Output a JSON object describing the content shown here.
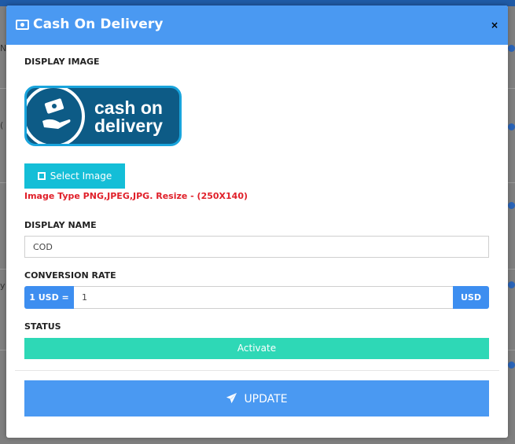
{
  "background": {
    "fragments": [
      "N",
      "(",
      "y"
    ]
  },
  "modal": {
    "title": "Cash On Delivery",
    "close_label": "×",
    "display_image_label": "DISPLAY IMAGE",
    "logo": {
      "line1": "cash on",
      "line2": "delivery"
    },
    "select_image_button": "Select Image",
    "image_hint": "Image Type PNG,JPEG,JPG. Resize - (250X140)",
    "display_name_label": "DISPLAY NAME",
    "display_name_value": "COD",
    "conversion_rate_label": "CONVERSION RATE",
    "rate_prefix": "1 USD =",
    "rate_value": "1",
    "rate_suffix": "USD",
    "status_label": "STATUS",
    "status_button": "Activate",
    "update_button": "UPDATE"
  },
  "colors": {
    "header": "#4a99f2",
    "select_button": "#14bed7",
    "hint_text": "#e0202a",
    "status_button": "#2ed8b6",
    "addon": "#3d8ef0"
  }
}
